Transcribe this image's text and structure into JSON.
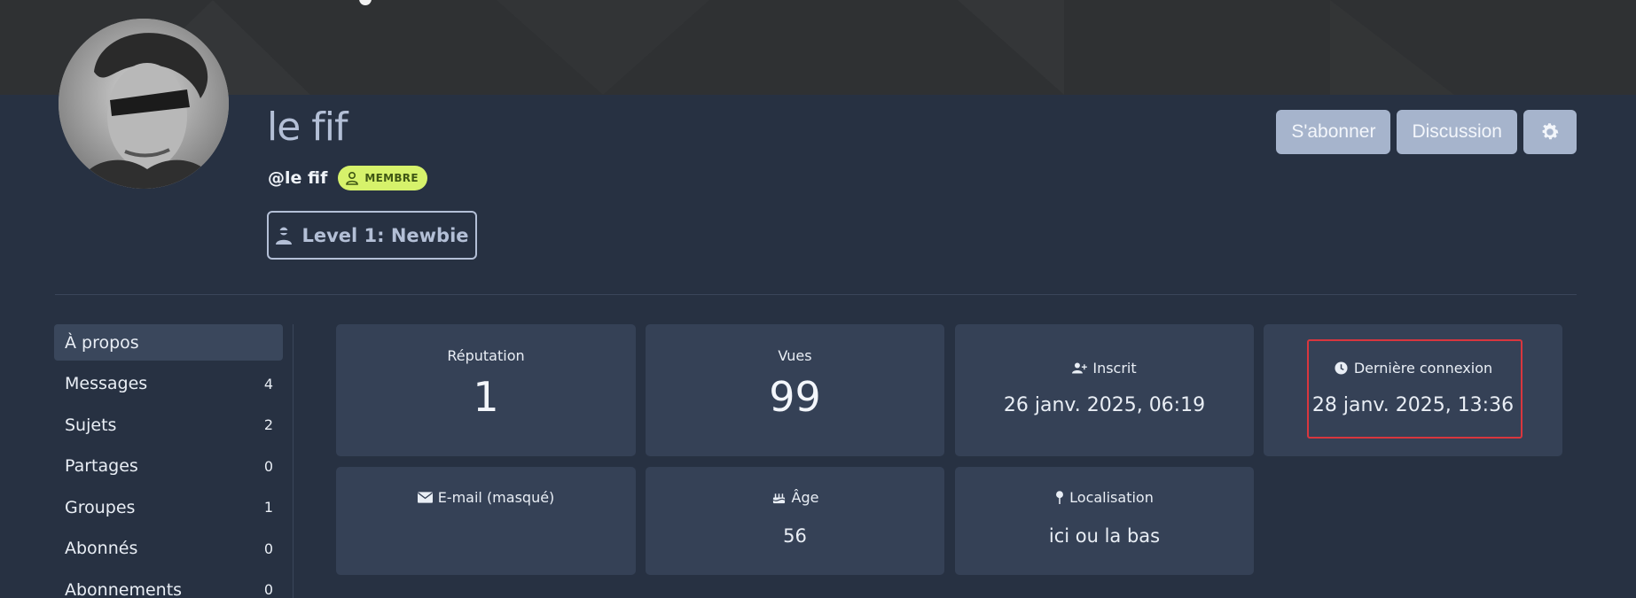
{
  "profile": {
    "display_name": "le fif",
    "handle": "@le fif",
    "role_badge": "MEMBRE",
    "level": "Level 1: Newbie"
  },
  "actions": {
    "subscribe": "S'abonner",
    "chat": "Discussion",
    "settings_icon": "gear-icon"
  },
  "sidebar": {
    "items": [
      {
        "label": "À propos",
        "count": "",
        "active": true
      },
      {
        "label": "Messages",
        "count": "4"
      },
      {
        "label": "Sujets",
        "count": "2"
      },
      {
        "label": "Partages",
        "count": "0"
      },
      {
        "label": "Groupes",
        "count": "1"
      },
      {
        "label": "Abonnés",
        "count": "0"
      },
      {
        "label": "Abonnements",
        "count": "0"
      }
    ]
  },
  "stats": {
    "reputation": {
      "label": "Réputation",
      "value": "1"
    },
    "views": {
      "label": "Vues",
      "value": "99"
    },
    "joined": {
      "label": "Inscrit",
      "value": "26 janv. 2025, 06:19",
      "icon": "user-plus-icon"
    },
    "last_login": {
      "label": "Dernière connexion",
      "value": "28 janv. 2025, 13:36",
      "icon": "clock-icon"
    },
    "email": {
      "label": "E-mail (masqué)",
      "value": "",
      "icon": "envelope-icon"
    },
    "age": {
      "label": "Âge",
      "value": "56",
      "icon": "birthday-cake-icon"
    },
    "location": {
      "label": "Localisation",
      "value": "ici ou la bas",
      "icon": "map-pin-icon"
    }
  },
  "colors": {
    "background": "#273142",
    "card": "#354156",
    "button": "#a6b4cc",
    "badge": "#d6f26b",
    "highlight": "#d9363e"
  }
}
